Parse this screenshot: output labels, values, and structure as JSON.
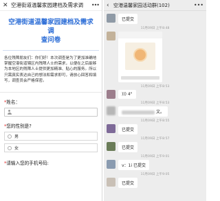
{
  "left": {
    "close_glyph": "✕",
    "window_title": "空港街道温馨家园建档及需求调",
    "menu_glyph": "•••",
    "survey_title_line1": "空港街道温馨家园建档及需求调",
    "survey_title_line2": "查问卷",
    "intro": "各位残障朋友们：你们好！本次调查是为了更加准确地掌握空港街道辖区内残障人士的需求，以便在之后能够为本地区的残障人士提供更加精准、贴心的服务。所以只需真实表达自己的想法和需求即可，请放心回答和填写，调查员会严格保密。",
    "questions": {
      "name": {
        "label": "姓名：",
        "required": "*"
      },
      "gender": {
        "label": "您的性别是?",
        "required": "*",
        "options": [
          "男",
          "女"
        ]
      },
      "phone": {
        "label": "请输入您的手机号码:",
        "required": "*"
      }
    }
  },
  "right": {
    "back_glyph": "‹",
    "window_title": "空港温馨家园活动群(102)",
    "menu_glyph": "•••",
    "messages": [
      {
        "text": "已提交",
        "avatar_color": "#8f9aa6"
      },
      {
        "time": "11月09日 上午8:48"
      },
      {
        "text": "",
        "avatar_color": "#c3b29a"
      },
      {
        "time": "11月09日 上午8:53"
      },
      {
        "text": "))) 4\"",
        "avatar_color": "#9c7e8c"
      },
      {
        "time": "11月09日 上午8:53"
      },
      {
        "text": "文。",
        "avatar_color": "#b6b6b6"
      },
      {
        "time": "11月09日 上午8:55"
      },
      {
        "text": "已提交",
        "avatar_color": "#7e6a98"
      },
      {
        "time": "11月09日 上午8:57"
      },
      {
        "text": "已提交",
        "avatar_color": "#6a7c58"
      },
      {
        "time": "11月09日 上午9:01"
      },
      {
        "text": "v：1i 已提交",
        "avatar_color": "#8a9bb0"
      },
      {
        "time": "11月09日 上午9:05"
      },
      {
        "text": "已提交",
        "avatar_color": "#c9c0b6"
      }
    ]
  }
}
